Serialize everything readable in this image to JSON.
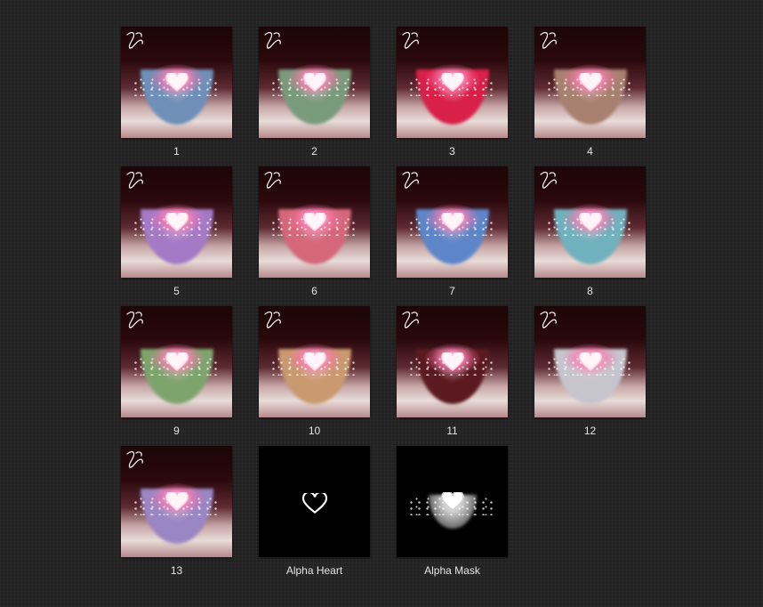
{
  "tiles": [
    {
      "label": "1",
      "kind": "eye",
      "iris_color": "#6d8fb8"
    },
    {
      "label": "2",
      "kind": "eye",
      "iris_color": "#7a9a7c"
    },
    {
      "label": "3",
      "kind": "eye",
      "iris_color": "#d82049"
    },
    {
      "label": "4",
      "kind": "eye",
      "iris_color": "#a8806f"
    },
    {
      "label": "5",
      "kind": "eye",
      "iris_color": "#a47ac6"
    },
    {
      "label": "6",
      "kind": "eye",
      "iris_color": "#d4687a"
    },
    {
      "label": "7",
      "kind": "eye",
      "iris_color": "#5d86c8"
    },
    {
      "label": "8",
      "kind": "eye",
      "iris_color": "#6fb1bd"
    },
    {
      "label": "9",
      "kind": "eye",
      "iris_color": "#7ea46e"
    },
    {
      "label": "10",
      "kind": "eye",
      "iris_color": "#c9996f"
    },
    {
      "label": "11",
      "kind": "eye",
      "iris_color": "#5a1a1f"
    },
    {
      "label": "12",
      "kind": "eye",
      "iris_color": "#c6c4cc"
    },
    {
      "label": "13",
      "kind": "eye",
      "iris_color": "#9a86c2"
    },
    {
      "label": "Alpha Heart",
      "kind": "alpha-heart"
    },
    {
      "label": "Alpha Mask",
      "kind": "alpha-mask"
    }
  ]
}
